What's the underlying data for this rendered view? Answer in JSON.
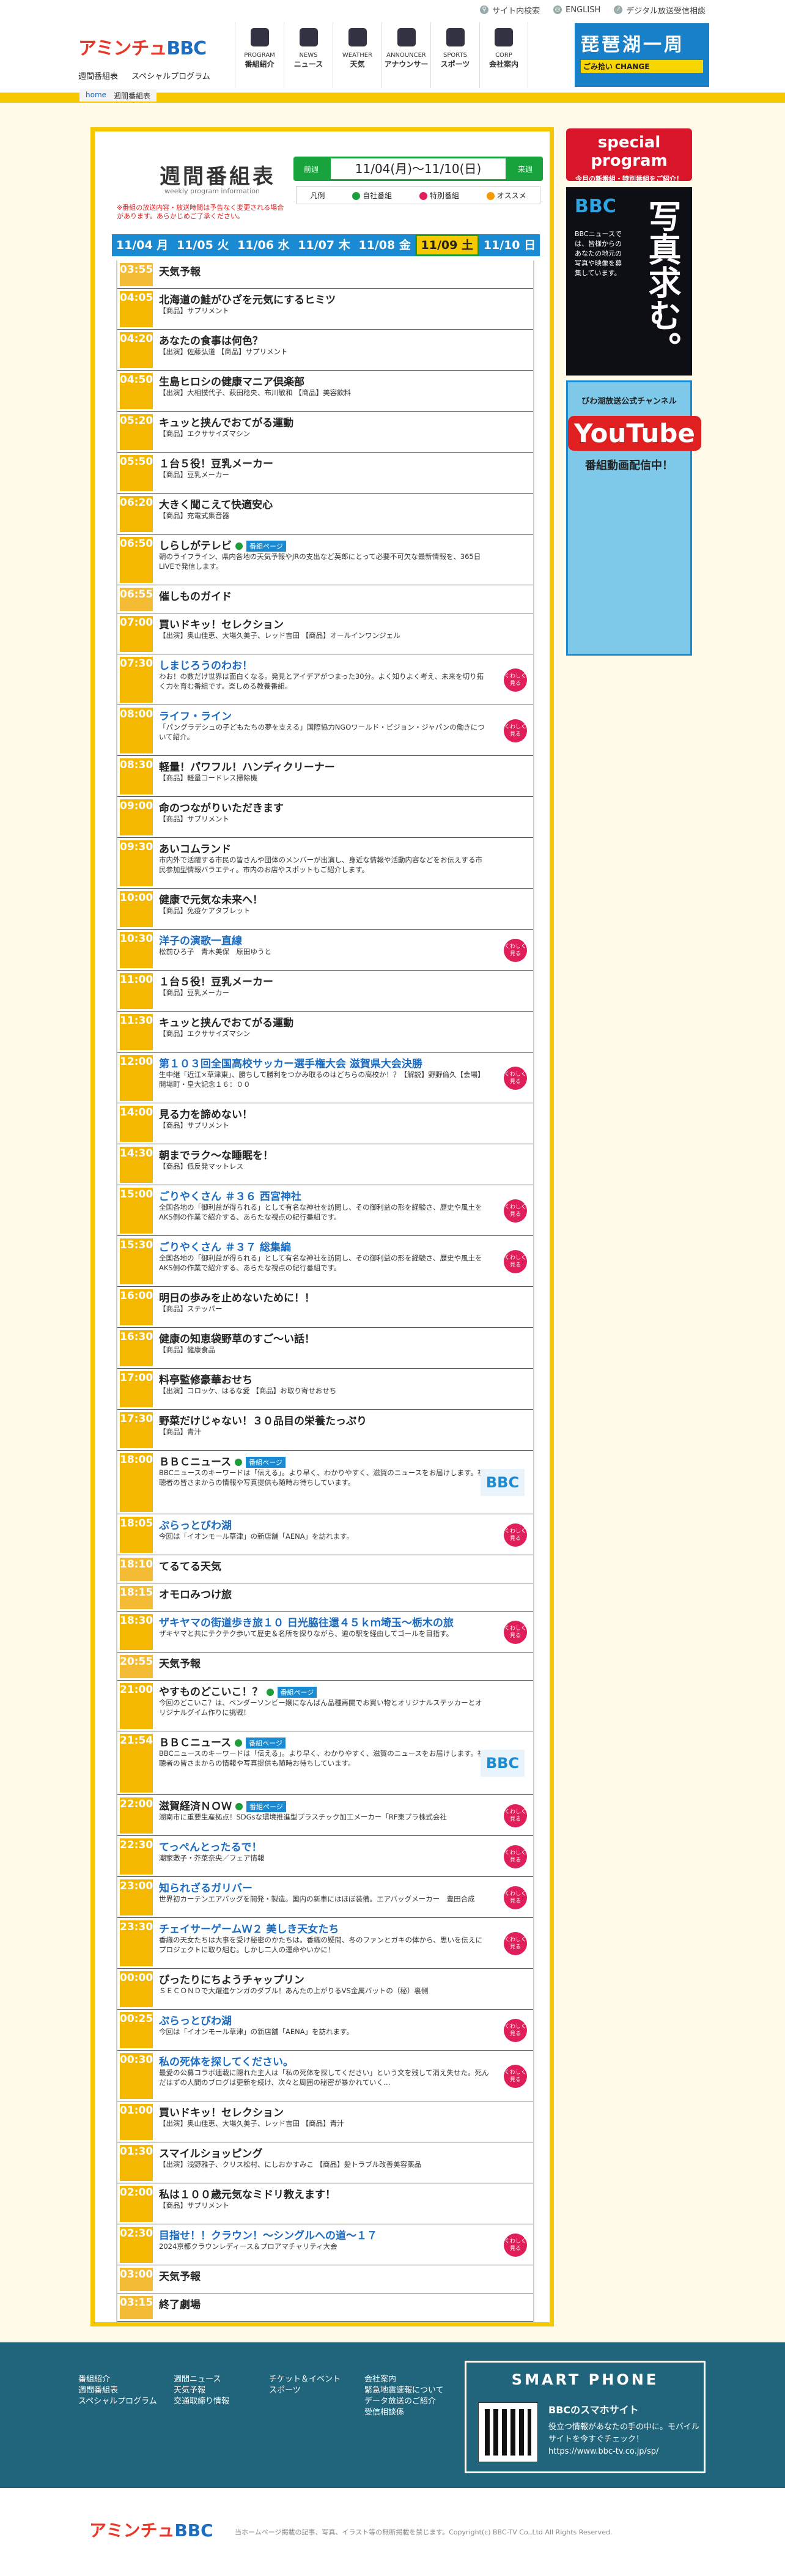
{
  "topbar": [
    "サイト内検索",
    "ENGLISH",
    "デジタル放送受信相談"
  ],
  "brand": {
    "logo_a": "アミンチュ",
    "logo_b": "BBC",
    "sub": [
      "週間番組表",
      "スペシャルプログラム"
    ]
  },
  "gnav": [
    {
      "en": "PROGRAM",
      "jp": "番組紹介",
      "icon": "tv-icon"
    },
    {
      "en": "NEWS",
      "jp": "ニュース",
      "icon": "news-icon"
    },
    {
      "en": "WEATHER",
      "jp": "天気",
      "icon": "cloud-icon"
    },
    {
      "en": "ANNOUNCER",
      "jp": "アナウンサー",
      "icon": "mic-icon"
    },
    {
      "en": "SPORTS",
      "jp": "スポーツ",
      "icon": "sports-icon"
    },
    {
      "en": "CORP",
      "jp": "会社案内",
      "icon": "building-icon"
    }
  ],
  "hbanner": {
    "title": "琵琶湖一周",
    "sub": "ごみ拾い CHANGE"
  },
  "breadcrumb": [
    "home",
    "週間番組表"
  ],
  "page": {
    "title": "週間番組表",
    "en": "weekly program information",
    "note": "※番組の放送内容・放送時間は予告なく変更される場合があります。あらかじめご了承ください。"
  },
  "week": {
    "prev": "前週",
    "next": "来週",
    "range": "11/04(月)〜11/10(日)"
  },
  "legend": [
    {
      "label": "凡例",
      "color": ""
    },
    {
      "label": "自社番組",
      "color": "#1e9e3a"
    },
    {
      "label": "特別番組",
      "color": "#e01e5a"
    },
    {
      "label": "オススメ",
      "color": "#f39a00"
    }
  ],
  "days": [
    "11/04 月",
    "11/05 火",
    "11/06 水",
    "11/07 木",
    "11/08 金",
    "11/09 土",
    "11/10 日"
  ],
  "active_day": 5,
  "programs": [
    {
      "t": "03:55",
      "title": "天気予報"
    },
    {
      "t": "04:05",
      "title": "北海道の鮭がひざを元気にするヒミツ",
      "desc": "【商品】サプリメント"
    },
    {
      "t": "04:20",
      "title": "あなたの食事は何色？",
      "desc": "【出演】佐藤弘道 【商品】サプリメント"
    },
    {
      "t": "04:50",
      "title": "生島ヒロシの健康マニア倶楽部",
      "desc": "【出演】大相撲代子、萩田稔央、布川敏和 【商品】美容飲料"
    },
    {
      "t": "05:20",
      "title": "キュッと挟んでおてがる運動",
      "desc": "【商品】エクササイズマシン"
    },
    {
      "t": "05:50",
      "title": "１台５役！豆乳メーカー",
      "desc": "【商品】豆乳メーカー"
    },
    {
      "t": "06:20",
      "title": "大きく聞こえて快適安心",
      "desc": "【商品】充電式集音器"
    },
    {
      "t": "06:50",
      "title": "しらしがテレビ",
      "badge": "番組ページ",
      "own": true,
      "desc": "朝のライフライン、県内各地の天気予報やJRの支出など英郎にとって必要不可欠な最新情報を、365日LIVEで発信します。"
    },
    {
      "t": "06:55",
      "title": "催しものガイド"
    },
    {
      "t": "07:00",
      "title": "買いドキッ！セレクション",
      "desc": "【出演】奥山佳恵、大場久美子、レッド吉田 【商品】オールインワンジェル"
    },
    {
      "t": "07:30",
      "title": "しまじろうのわお！",
      "blue": true,
      "pin": true,
      "desc": "わお！の数だけ世界は面白くなる。発見とアイデアがつまった30分。よく知りよく考え、未来を切り拓く力を育む番組です。楽しめる教養番組。"
    },
    {
      "t": "08:00",
      "title": "ライフ・ライン",
      "blue": true,
      "pin": true,
      "desc": "「パングラデシュの子どもたちの夢を支える」国際協力NGOワールド・ビジョン・ジャパンの働きについて紹介。"
    },
    {
      "t": "08:30",
      "title": "軽量！パワフル！ハンディクリーナー",
      "desc": "【商品】軽量コードレス掃除機"
    },
    {
      "t": "09:00",
      "title": "命のつながりいただきます",
      "desc": "【商品】サプリメント"
    },
    {
      "t": "09:30",
      "title": "あいコムランド",
      "desc": "市内外で活躍する市民の皆さんや団体のメンバーが出演し、身近な情報や活動内容などをお伝えする市民参加型情報バラエティ。市内のお店やスポットもご紹介します。"
    },
    {
      "t": "10:00",
      "title": "健康で元気な未来へ！",
      "desc": "【商品】免疫ケアタブレット"
    },
    {
      "t": "10:30",
      "title": "洋子の演歌一直線",
      "blue": true,
      "pin": true,
      "desc": "松前ひろ子　青木美保　原田ゆうと"
    },
    {
      "t": "11:00",
      "title": "１台５役！豆乳メーカー",
      "desc": "【商品】豆乳メーカー"
    },
    {
      "t": "11:30",
      "title": "キュッと挟んでおてがる運動",
      "desc": "【商品】エクササイズマシン"
    },
    {
      "t": "12:00",
      "title": "第１０３回全国高校サッカー選手権大会 滋賀県大会決勝",
      "blue": true,
      "pin": true,
      "desc": "生中継「近江×草津東」、勝ちして勝利をつかみ取るのはどちらの高校か！？【解説】野野倫久【会場】開場町・皇大記念１６：００"
    },
    {
      "t": "14:00",
      "title": "見る力を諦めない！",
      "desc": "【商品】サプリメント"
    },
    {
      "t": "14:30",
      "title": "朝までラク〜な睡眠を！",
      "desc": "【商品】低反発マットレス"
    },
    {
      "t": "15:00",
      "title": "ごりやくさん ＃３６ 西宮神社",
      "blue": true,
      "pin": true,
      "desc": "全国各地の「御利益が得られる」として有名な神社を訪問し、その御利益の形を経験さ、歴史や風土をAKS側の作業で紹介する、あらたな視点の紀行番組です。"
    },
    {
      "t": "15:30",
      "title": "ごりやくさん ＃３７ 総集編",
      "blue": true,
      "pin": true,
      "desc": "全国各地の「御利益が得られる」として有名な神社を訪問し、その御利益の形を経験さ、歴史や風土をAKS側の作業で紹介する、あらたな視点の紀行番組です。"
    },
    {
      "t": "16:00",
      "title": "明日の歩みを止めないために！！",
      "desc": "【商品】ステッパー"
    },
    {
      "t": "16:30",
      "title": "健康の知恵袋野草のすご〜い話！",
      "desc": "【商品】健康食品"
    },
    {
      "t": "17:00",
      "title": "料亭監修豪華おせち",
      "desc": "【出演】コロッケ、はるな愛 【商品】お取り寄せおせち"
    },
    {
      "t": "17:30",
      "title": "野菜だけじゃない！３０品目の栄養たっぷり",
      "desc": "【商品】青汁"
    },
    {
      "t": "18:00",
      "title": "ＢＢＣニュース",
      "badge": "番組ページ",
      "own": true,
      "thumb": "BBC",
      "desc": "BBCニュースのキーワードは「伝える」。より早く、わかりやすく、滋賀のニュースをお届けします。視聴者の皆さまからの情報や写真提供も随時お待ちしています。"
    },
    {
      "t": "18:05",
      "title": "ぷらっとびわ湖",
      "blue": true,
      "pin": true,
      "desc": "今回は「イオンモール草津」の新店舗「AENA」を訪れます。"
    },
    {
      "t": "18:10",
      "title": "てるてる天気"
    },
    {
      "t": "18:15",
      "title": "オモロみつけ旅"
    },
    {
      "t": "18:30",
      "title": "ザキヤマの街道歩き旅１０ 日光脇往還４５ｋｍ埼玉〜栃木の旅",
      "blue": true,
      "pin": true,
      "desc": "ザキヤマと共にテクテク歩いて歴史＆名所を探りながら、道の駅を経由してゴールを目指す。"
    },
    {
      "t": "20:55",
      "title": "天気予報"
    },
    {
      "t": "21:00",
      "title": "やすものどこいこ！？",
      "badge": "番組ページ",
      "own": true,
      "desc": "今回のどこいこ？は、ベンダーソンビー嬢になんばん品種再開でお買い物とオリジナルステッカーとオリジナルグイム作りに挑戦！"
    },
    {
      "t": "21:54",
      "title": "ＢＢＣニュース",
      "badge": "番組ページ",
      "own": true,
      "thumb": "BBC",
      "desc": "BBCニュースのキーワードは「伝える」。より早く、わかりやすく、滋賀のニュースをお届けします。視聴者の皆さまからの情報や写真提供も随時お待ちしています。"
    },
    {
      "t": "22:00",
      "title": "滋賀経済ＮＯＷ",
      "badge": "番組ページ",
      "own": true,
      "pin": true,
      "desc": "湖南市に重要生産拠点！SDGsな環境推進型プラスチック加工メーカー「RF東プラ株式会社"
    },
    {
      "t": "22:30",
      "title": "てっぺんとったるで！",
      "blue": true,
      "pin": true,
      "desc": "潮家敷子・芥菜奈央／フェア情報"
    },
    {
      "t": "23:00",
      "title": "知られざるガリバー",
      "blue": true,
      "pin": true,
      "desc": "世界初カーテンエアバッグを開発・製造。国内の新車にはほぼ装備。エアバッグメーカー　豊田合成"
    },
    {
      "t": "23:30",
      "title": "チェイサーゲームＷ２ 美しき天女たち",
      "blue": true,
      "pin": true,
      "desc": "香織の天女たちは大事を受け秘密のかたちは。香織の疑問、冬のファンとガキの体から、思いを伝えにプロジェクトに取り組む。しかし二人の運命やいかに！"
    },
    {
      "t": "00:00",
      "title": "ぴったりにちようチャップリン",
      "desc": "ＳＥＣＯＮＤで大躍進ケンガのダブル！あんたの上がりるVS金属バットの（秘）裏側"
    },
    {
      "t": "00:25",
      "title": "ぷらっとびわ湖",
      "blue": true,
      "pin": true,
      "desc": "今回は「イオンモール草津」の新店舗「AENA」を訪れます。"
    },
    {
      "t": "00:30",
      "title": "私の死体を探してください。",
      "blue": true,
      "pin": true,
      "desc": "最愛の公募コラボ連載に隠れた主人は「私の死体を探してください」という文を残して消え失せた。死んだはずの人間のブログは更新を続け、次々と周囲の秘密が暴かれていく…"
    },
    {
      "t": "01:00",
      "title": "買いドキッ！セレクション",
      "desc": "【出演】奥山佳恵、大場久美子、レッド吉田 【商品】青汁"
    },
    {
      "t": "01:30",
      "title": "スマイルショッピング",
      "desc": "【出演】浅野雅子、クリス松村、にしおかすみこ 【商品】髪トラブル改善美容薬品"
    },
    {
      "t": "02:00",
      "title": "私は１００歳元気なミドリ教えます！",
      "desc": "【商品】サプリメント"
    },
    {
      "t": "02:30",
      "title": "目指せ！！クラウン！〜シングルへの道〜１７",
      "blue": true,
      "pin": true,
      "desc": "2024京都クラウンレディース＆プロアマチャリティ大会"
    },
    {
      "t": "03:00",
      "title": "天気予報"
    },
    {
      "t": "03:15",
      "title": "終了劇場"
    }
  ],
  "side": {
    "sp_title": "special program",
    "sp_sub": "今月の新番組・特別番組をご紹介！",
    "bbc": "BBC",
    "photo_big": "写真求む。",
    "photo_sub": "BBCニュースでは、皆様からのあなたの地元の写真や映像を募集しています。",
    "yt_title": "びわ湖放送公式チャンネル",
    "yt_logo": "YouTube",
    "yt_sub": "番組動画配信中！"
  },
  "footer": {
    "cols": [
      [
        "番組紹介",
        "週間番組表",
        "スペシャルプログラム"
      ],
      [
        "週間ニュース",
        "天気予報",
        "交通取締り情報"
      ],
      [
        "チケット＆イベント",
        "スポーツ"
      ],
      [
        "会社案内",
        "緊急地震速報について",
        "データ放送のご紹介",
        "受信相談係"
      ]
    ],
    "sp_title": "SMART PHONE",
    "sp_head": "BBCのスマホサイト",
    "sp_text": "役立つ情報があなたの手の中に。モバイルサイトを今すぐチェック！",
    "sp_url": "https://www.bbc-tv.co.jp/sp/"
  },
  "copyright": "当ホームページ掲載の記事、写真、イラスト等の無断掲載を禁じます。Copyright(c) BBC-TV Co.,Ltd All Rights Reserved."
}
